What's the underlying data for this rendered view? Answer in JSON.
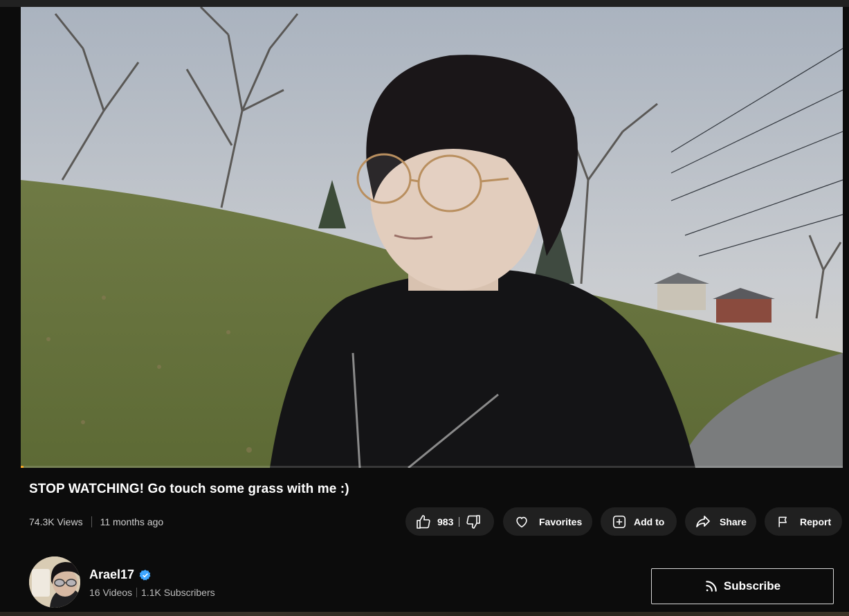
{
  "video": {
    "title": "STOP WATCHING! Go touch some grass with me :)",
    "views": "74.3K Views",
    "posted": "11 months ago",
    "progress_fraction": 0.003
  },
  "actions": {
    "like_count": "983",
    "like_icon": "thumbs-up-icon",
    "dislike_icon": "thumbs-down-icon",
    "favorites_label": "Favorites",
    "favorites_icon": "heart-icon",
    "add_to_label": "Add to",
    "add_to_icon": "plus-square-icon",
    "share_label": "Share",
    "share_icon": "share-arrow-icon",
    "report_label": "Report",
    "report_icon": "flag-icon"
  },
  "channel": {
    "name": "Arael17",
    "verified_icon": "verified-check-icon",
    "videos": "16 Videos",
    "subscribers": "1.1K Subscribers",
    "subscribe_label": "Subscribe",
    "subscribe_icon": "rss-icon"
  },
  "colors": {
    "background": "#0c0c0c",
    "pill": "#202020",
    "verified": "#3ea6ff",
    "progress": "#f5a623"
  }
}
